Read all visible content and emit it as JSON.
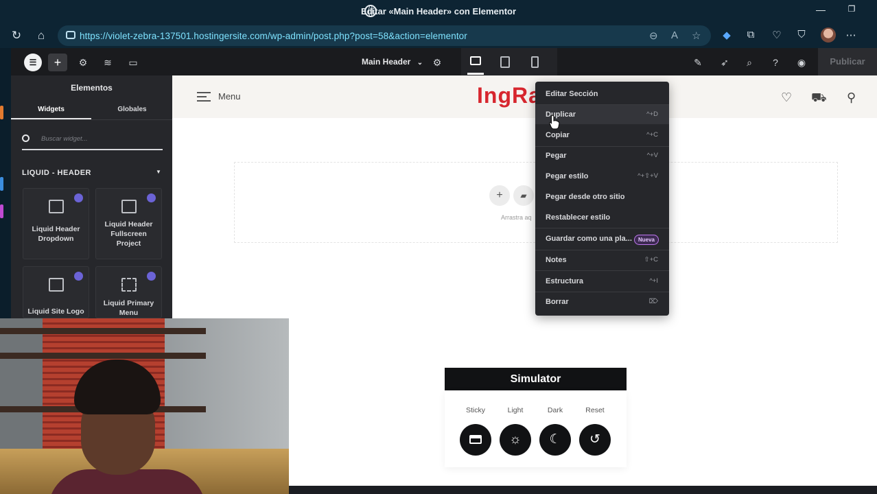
{
  "browser": {
    "window_title": "Editar «Main Header» con Elementor",
    "url": "https://violet-zebra-137501.hostingersite.com/wp-admin/post.php?post=58&action=elementor"
  },
  "elementor_topbar": {
    "document_name": "Main Header",
    "publish_label": "Publicar"
  },
  "panel": {
    "title": "Elementos",
    "tabs": [
      "Widgets",
      "Globales"
    ],
    "search_placeholder": "Buscar widget...",
    "category": "LIQUID - HEADER",
    "widgets": [
      {
        "label": "Liquid Header Dropdown",
        "icon": "list-icon"
      },
      {
        "label": "Liquid Header Fullscreen Project",
        "icon": "browser-window-icon"
      },
      {
        "label": "Liquid Site Logo",
        "icon": "keyboard-icon"
      },
      {
        "label": "Liquid Primary Menu",
        "icon": "menu-tree-icon"
      }
    ]
  },
  "site_header": {
    "menu_label": "Menu",
    "logo_part1": "Ing",
    "logo_part2": "Ra"
  },
  "dropzone": {
    "hint": "Arrastra aq"
  },
  "context_menu": {
    "items": [
      {
        "label": "Editar Sección",
        "shortcut": ""
      },
      {
        "label": "Duplicar",
        "shortcut": "^+D"
      },
      {
        "label": "Copiar",
        "shortcut": "^+C"
      },
      {
        "label": "Pegar",
        "shortcut": "^+V"
      },
      {
        "label": "Pegar estilo",
        "shortcut": "^+⇧+V"
      },
      {
        "label": "Pegar desde otro sitio",
        "shortcut": ""
      },
      {
        "label": "Restablecer estilo",
        "shortcut": ""
      },
      {
        "label": "Guardar como una pla...",
        "shortcut": ""
      },
      {
        "label": "Notes",
        "shortcut": "⇧+C"
      },
      {
        "label": "Estructura",
        "shortcut": "^+I"
      },
      {
        "label": "Borrar",
        "shortcut": "⌦"
      }
    ],
    "badge_new": "Nueva"
  },
  "simulator": {
    "title": "Simulator",
    "options": [
      {
        "label": "Sticky",
        "icon": "sticky-header-icon"
      },
      {
        "label": "Light",
        "icon": "sun-icon"
      },
      {
        "label": "Dark",
        "icon": "moon-icon"
      },
      {
        "label": "Reset",
        "icon": "reset-icon"
      }
    ]
  },
  "colors": {
    "elementor_dark": "#26272b",
    "logo_red": "#d7262e",
    "badge_purple": "#c079f0",
    "url_cyan": "#7fe3ff"
  }
}
